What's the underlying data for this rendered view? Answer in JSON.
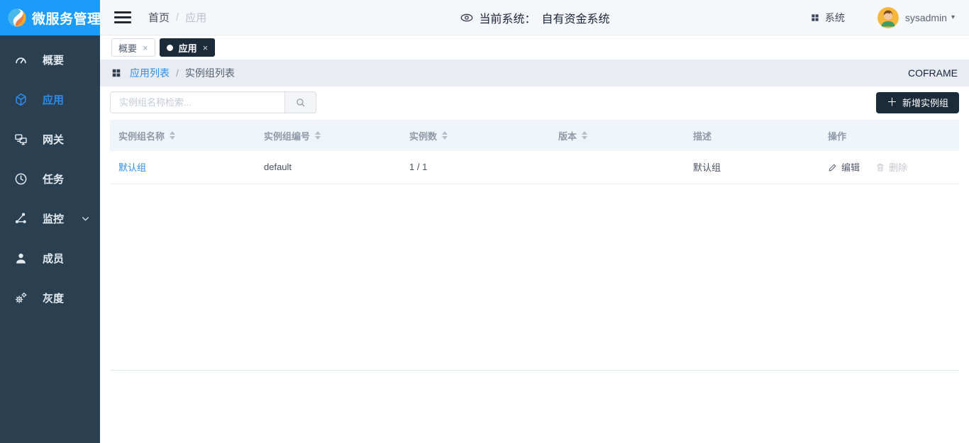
{
  "colors": {
    "brand_blue": "#1b9cfa",
    "sidebar_bg": "#2a3f50",
    "dark_navy": "#1c2b3a",
    "link_blue": "#2d8cf0",
    "table_header_bg": "#eff5fb"
  },
  "brand": {
    "title": "微服务管理"
  },
  "topbar": {
    "breadcrumb": {
      "home": "首页",
      "separator": "/",
      "current": "应用"
    },
    "current_system_label": "当前系统：",
    "current_system_value": "自有资金系统",
    "system_menu_label": "系统",
    "username": "sysadmin"
  },
  "icons": {
    "close": "×",
    "plus": "＋",
    "caret_down": "▾"
  },
  "tabs": [
    {
      "label": "概要"
    },
    {
      "label": "应用"
    }
  ],
  "page_header": {
    "parent": "应用列表",
    "separator": "/",
    "current": "实例组列表",
    "project": "COFRAME"
  },
  "toolbar": {
    "search_placeholder": "实例组名称检索...",
    "add_label": "新增实例组"
  },
  "sidebar": {
    "items": [
      {
        "label": "概要"
      },
      {
        "label": "应用"
      },
      {
        "label": "网关"
      },
      {
        "label": "任务"
      },
      {
        "label": "监控"
      },
      {
        "label": "成员"
      },
      {
        "label": "灰度"
      }
    ]
  },
  "table": {
    "headers": [
      {
        "label": "实例组名称"
      },
      {
        "label": "实例组编号"
      },
      {
        "label": "实例数"
      },
      {
        "label": "版本"
      },
      {
        "label": "描述"
      },
      {
        "label": "操作"
      }
    ],
    "rows": [
      {
        "name": "默认组",
        "code": "default",
        "instances": "1 / 1",
        "version": "",
        "description": "默认组",
        "edit_label": "编辑",
        "delete_label": "删除"
      }
    ]
  }
}
